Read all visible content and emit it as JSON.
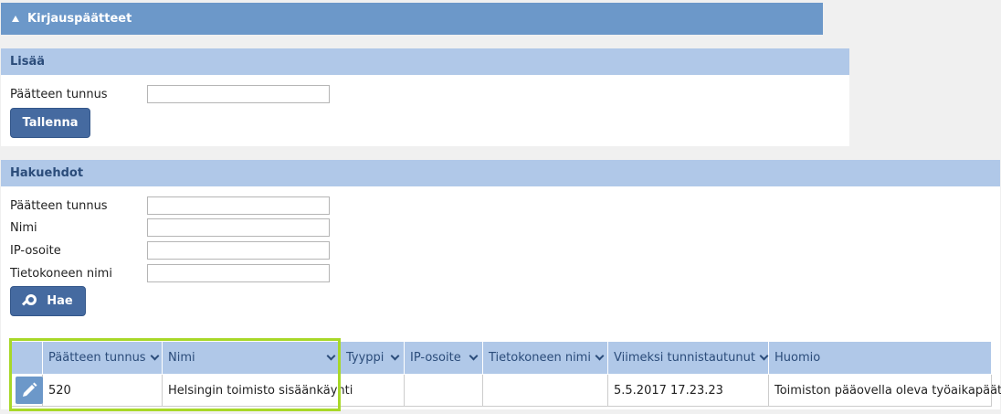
{
  "header": {
    "title": "Kirjauspäätteet"
  },
  "add_panel": {
    "title": "Lisää",
    "terminal_id_label": "Päätteen tunnus",
    "terminal_id_value": "",
    "save_label": "Tallenna"
  },
  "search_panel": {
    "title": "Hakuehdot",
    "fields": [
      {
        "label": "Päätteen tunnus",
        "value": ""
      },
      {
        "label": "Nimi",
        "value": ""
      },
      {
        "label": "IP-osoite",
        "value": ""
      },
      {
        "label": "Tietokoneen nimi",
        "value": ""
      }
    ],
    "search_label": "Hae"
  },
  "table": {
    "columns": [
      "Päätteen tunnus",
      "Nimi",
      "Tyyppi",
      "IP-osoite",
      "Tietokoneen nimi",
      "Viimeksi tunnistautunut",
      "Huomio"
    ],
    "rows": [
      [
        "520",
        "Helsingin toimisto sisäänkäynti",
        "",
        "",
        "",
        "5.5.2017 17.23.23",
        "Toimiston pääovella oleva työaikapääte"
      ]
    ]
  },
  "icons": {
    "collapse": "triangle-up-icon",
    "search": "search-icon",
    "edit": "pencil-icon",
    "sort": "chevron-down-icon"
  },
  "colors": {
    "header": "#6c98c9",
    "panel_header": "#b0c8e8",
    "button": "#456aa0",
    "highlight": "#a8d828"
  }
}
